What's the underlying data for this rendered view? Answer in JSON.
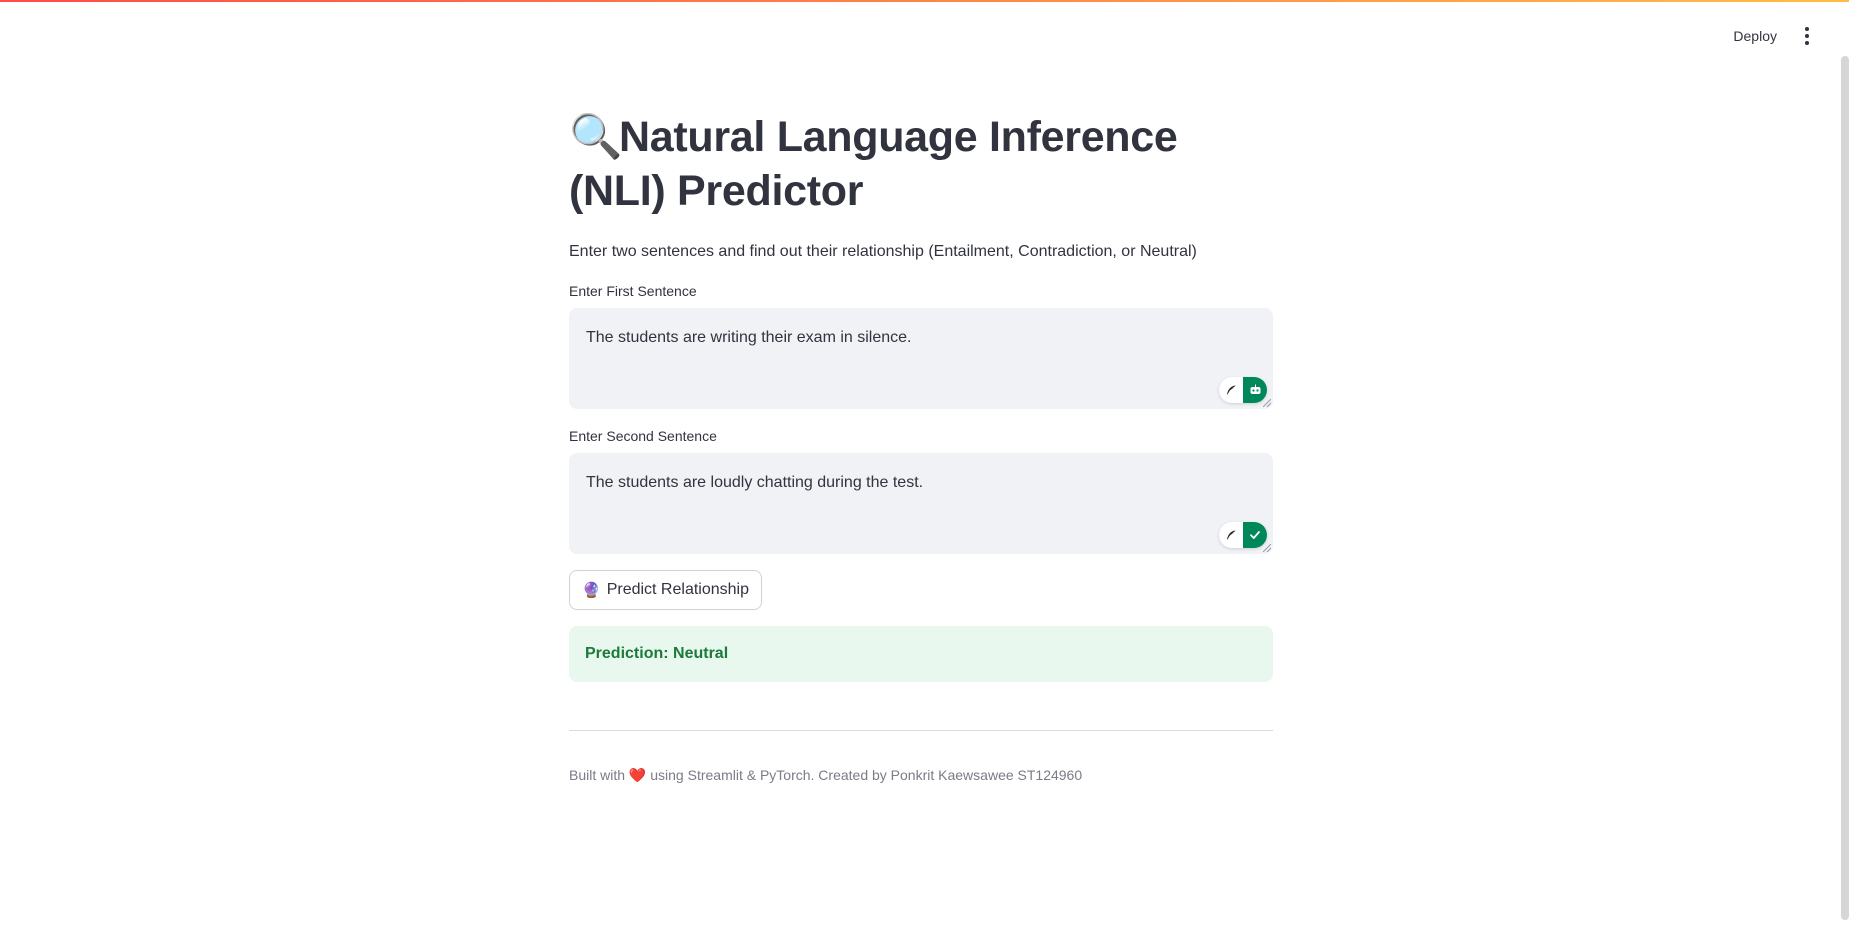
{
  "header": {
    "deploy_label": "Deploy"
  },
  "page": {
    "title_icon": "🔍",
    "title": "Natural Language Inference (NLI) Predictor",
    "subtitle": "Enter two sentences and find out their relationship (Entailment, Contradiction, or Neutral)"
  },
  "form": {
    "first_label": "Enter First Sentence",
    "first_value": "The students are writing their exam in silence.",
    "second_label": "Enter Second Sentence",
    "second_value": "The students are loudly chatting during the test.",
    "predict_icon": "🔮",
    "predict_label": "Predict Relationship"
  },
  "result": {
    "text": "Prediction: Neutral"
  },
  "footer": {
    "text_before": "Built with",
    "heart": "❤️",
    "text_after": "using Streamlit & PyTorch. Created by Ponkrit Kaewsawee ST124960"
  },
  "colors": {
    "accent_gradient_start": "#ff4b4b",
    "accent_gradient_end": "#ffbd45",
    "input_background": "#f0f2f6",
    "success_background": "#e8f8ee",
    "success_text": "#1d7a3a",
    "extension_green": "#00875a"
  },
  "icons": {
    "menu": "kebab-menu-icon",
    "extension_left": "feather-icon",
    "extension_first_status": "robot-icon",
    "extension_second_status": "checkmark-icon"
  }
}
